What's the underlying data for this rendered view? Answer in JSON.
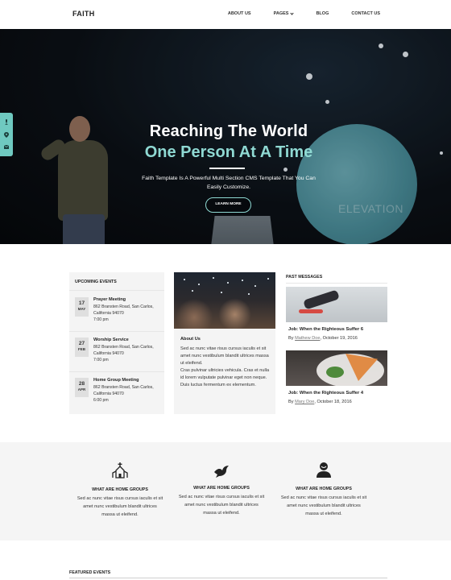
{
  "header": {
    "logo": "FAITH",
    "nav": [
      {
        "label": "ABOUT US"
      },
      {
        "label": "PAGES",
        "has_dropdown": true
      },
      {
        "label": "BLOG"
      },
      {
        "label": "CONTACT US"
      }
    ]
  },
  "hero": {
    "title": "Reaching The World",
    "subtitle": "One Person At A Time",
    "description": "Faith Template Is A Powerful Multi Section CMS Template That You Can Easily Customize.",
    "button": "LEARN MORE",
    "screen_text": "ELEVATION",
    "accent_color": "#8fd9d3"
  },
  "side_tab": {
    "icons": [
      "microphone-icon",
      "map-pin-icon",
      "envelope-icon"
    ]
  },
  "upcoming_events": {
    "title": "UPCOMING EVENTS",
    "items": [
      {
        "day": "17",
        "month": "MAY",
        "title": "Prayer Meeting",
        "address1": "862 Bransten Road, San Carlos,",
        "address2": "California 94070",
        "time": "7:00 pm"
      },
      {
        "day": "27",
        "month": "FEB",
        "title": "Worship Service",
        "address1": "862 Bransten Road, San Carlos,",
        "address2": "California 94070",
        "time": "7:00 pm"
      },
      {
        "day": "28",
        "month": "APR",
        "title": "Home Group Meeting",
        "address1": "862 Bransten Road, San Carlos,",
        "address2": "California 94070",
        "time": "6:00 pm"
      }
    ]
  },
  "about": {
    "title": "About Us",
    "paragraph1": "Sed ac nunc vitae risus cursus iaculis et sit amet nunc vestibulum blandit ultrices massa ut eleifend.",
    "paragraph2": "Cras pulvinar ultricies vehicula. Cras et nulla id lorem vulputate pulvinar eget non neque.",
    "paragraph3": "Duis luctus fermentum ex elementum."
  },
  "past_messages": {
    "title": "PAST MESSAGES",
    "items": [
      {
        "title": "Job: When the Righteous Suffer 6",
        "by": "By",
        "author": "Mathew Doe",
        "date": ", October 19, 2016"
      },
      {
        "title": "Job: When the Righteous Suffer 4",
        "by": "By",
        "author": "Mary Doe",
        "date": ", October 18, 2016"
      }
    ]
  },
  "groups": [
    {
      "icon": "church-icon",
      "title": "WHAT ARE HOME GROUPS",
      "line1": "Sed ac nunc vitae risus cursus iaculis et sit",
      "line2": "amet nunc vestibulum blandit ultrices",
      "line3": "massa ut eleifend."
    },
    {
      "icon": "dove-icon",
      "title": "WHAT ARE HOME GROUPS",
      "line1": "Sed ac nunc vitae risus cursus iaculis et sit",
      "line2": "amet nunc vestibulum blandit ultrices",
      "line3": "massa ut eleifend."
    },
    {
      "icon": "person-icon",
      "title": "WHAT ARE HOME GROUPS",
      "line1": "Sed ac nunc vitae risus cursus iaculis et sit",
      "line2": "amet nunc vestibulum blandit ultrices",
      "line3": "massa ut eleifend."
    }
  ],
  "featured": {
    "title": "FEATURED EVENTS"
  }
}
